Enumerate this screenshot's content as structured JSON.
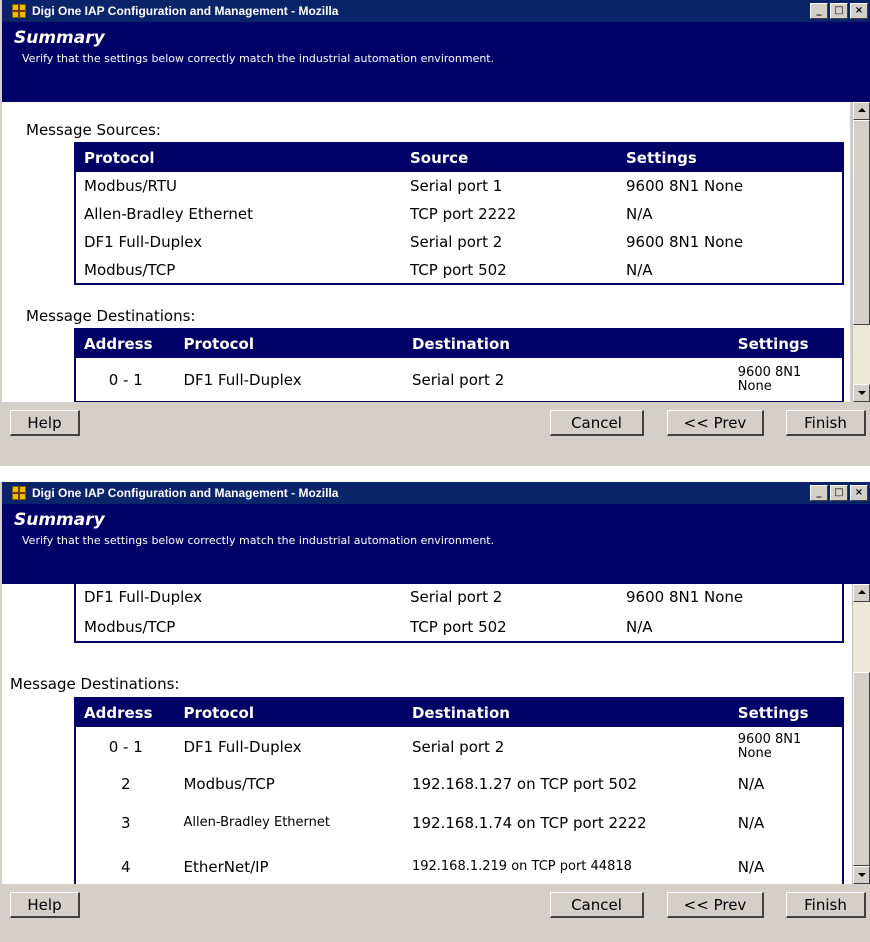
{
  "window": {
    "title": "Digi One IAP Configuration and Management - Mozilla",
    "controls": [
      "_",
      "□",
      "×"
    ]
  },
  "header": {
    "title": "Summary",
    "subtitle": "Verify that the settings below correctly match the industrial automation environment."
  },
  "top": {
    "sources_label": "Message Sources:",
    "sources_headers": [
      "Protocol",
      "Source",
      "Settings"
    ],
    "sources_rows": [
      [
        "Modbus/RTU",
        "Serial port 1",
        "9600 8N1 None"
      ],
      [
        "Allen-Bradley Ethernet",
        "TCP port 2222",
        "N/A"
      ],
      [
        "DF1 Full-Duplex",
        "Serial port 2",
        "9600 8N1 None"
      ],
      [
        "Modbus/TCP",
        "TCP port 502",
        "N/A"
      ]
    ],
    "dest_label": "Message Destinations:",
    "dest_headers": [
      "Address",
      "Protocol",
      "Destination",
      "Settings"
    ],
    "dest_rows": [
      [
        "0 - 1",
        "DF1 Full-Duplex",
        "Serial port 2",
        "9600 8N1 None"
      ]
    ]
  },
  "bottom": {
    "sources_rows": [
      [
        "DF1 Full-Duplex",
        "Serial port 2",
        "9600 8N1 None"
      ],
      [
        "Modbus/TCP",
        "TCP port 502",
        "N/A"
      ]
    ],
    "dest_label": "Message Destinations:",
    "dest_headers": [
      "Address",
      "Protocol",
      "Destination",
      "Settings"
    ],
    "dest_rows": [
      [
        "0 - 1",
        "DF1 Full-Duplex",
        "Serial port 2",
        "9600 8N1 None"
      ],
      [
        "2",
        "Modbus/TCP",
        "192.168.1.27 on TCP port 502",
        "N/A"
      ],
      [
        "3",
        "Allen-Bradley Ethernet",
        "192.168.1.74 on TCP port 2222",
        "N/A"
      ],
      [
        "4",
        "EtherNet/IP",
        "192.168.1.219 on TCP port 44818",
        "N/A"
      ]
    ]
  },
  "buttons": {
    "help": "Help",
    "cancel": "Cancel",
    "prev": "<< Prev",
    "finish": "Finish"
  }
}
